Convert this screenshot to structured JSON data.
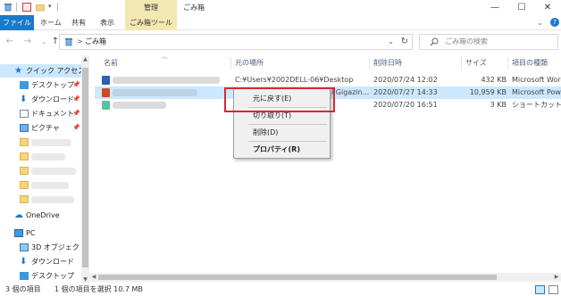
{
  "titlebar": {
    "manage_label": "管理",
    "window_title": "ごみ箱",
    "minimize": "—",
    "maximize": "☐",
    "close": "✕"
  },
  "ribbon": {
    "file": "ファイル",
    "home": "ホーム",
    "share": "共有",
    "view": "表示",
    "tools": "ごみ箱ツール",
    "help": "?"
  },
  "nav": {
    "back": "←",
    "forward": "→",
    "recent": "⌄",
    "up": "↑",
    "address": "ごみ箱",
    "address_sep": ">",
    "address_dropdown": "⌄",
    "refresh": "↻",
    "search_placeholder": "ごみ箱の検索"
  },
  "sidebar": {
    "quick_access": "クイック アクセス",
    "desktop": "デスクトップ",
    "downloads": "ダウンロード",
    "documents": "ドキュメント",
    "pictures": "ピクチャ",
    "onedrive": "OneDrive",
    "pc": "PC",
    "objects3d": "3D オブジェクト",
    "downloads2": "ダウンロード",
    "desktop2": "デスクトップ",
    "pin": "📌"
  },
  "columns": {
    "name": "名前",
    "original": "元の場所",
    "deleted": "削除日時",
    "size": "サイズ",
    "type": "項目の種類"
  },
  "rows": [
    {
      "original": "C:¥Users¥2002DELL-06¥Desktop",
      "deleted": "2020/07/24 12:02",
      "size": "432 KB",
      "type": "Microsoft Word"
    },
    {
      "original": "l Gigazin...",
      "deleted": "2020/07/27 14:33",
      "size": "10,959 KB",
      "type": "Microsoft Powe"
    },
    {
      "original": "",
      "deleted": "2020/07/20 16:51",
      "size": "3 KB",
      "type": "ショートカット"
    }
  ],
  "context_menu": {
    "restore": "元に戻す(E)",
    "cut": "切り取り(T)",
    "delete": "削除(D)",
    "properties": "プロパティ(R)"
  },
  "status": {
    "item_count": "3 個の項目",
    "selected": "1 個の項目を選択  10.7 MB"
  },
  "colors": {
    "accent": "#1979ca",
    "selection": "#cce8ff",
    "manage_tab": "#f3e7b2",
    "highlight_box": "#d8282f"
  }
}
